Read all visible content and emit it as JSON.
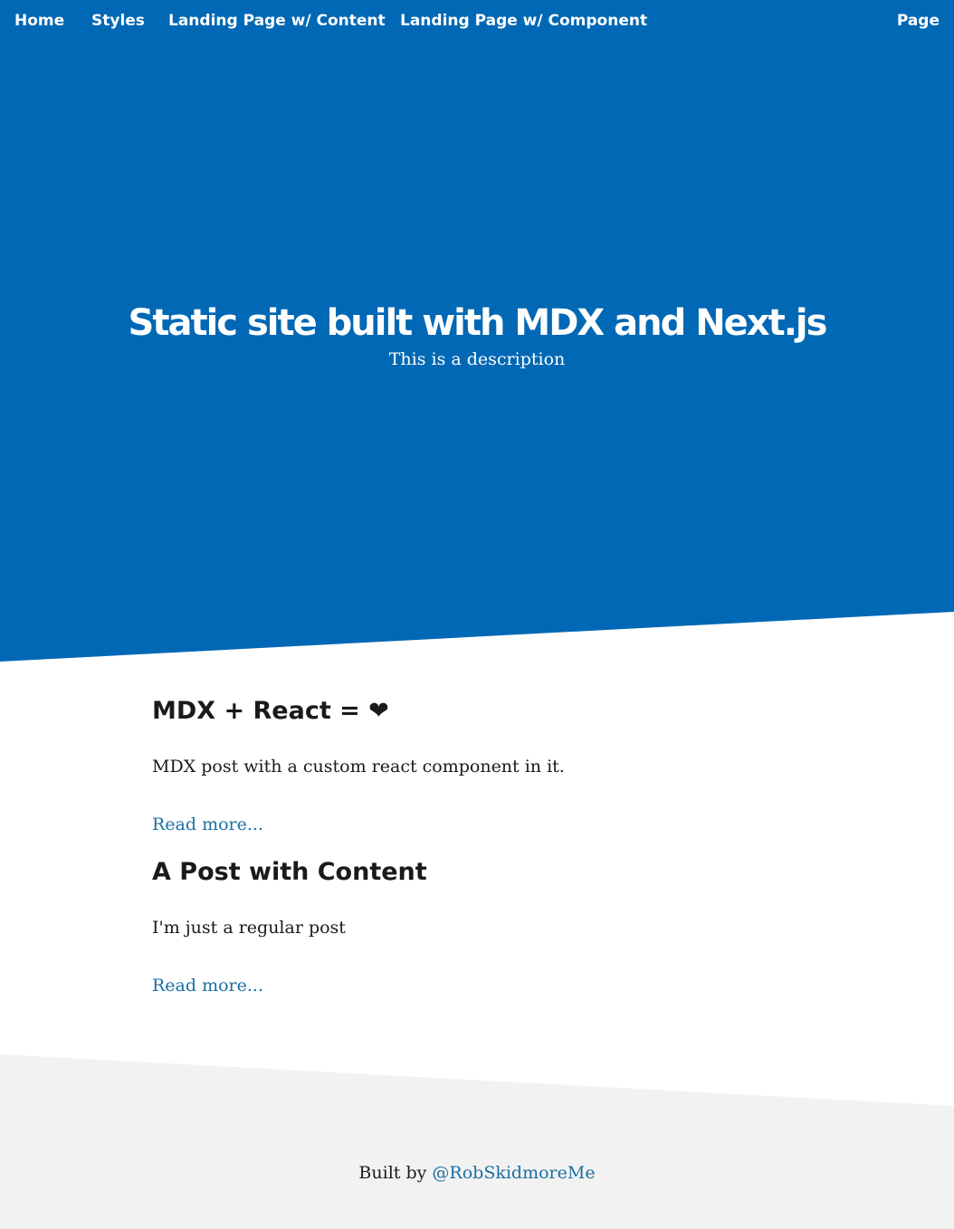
{
  "nav": {
    "home": "Home",
    "styles": "Styles",
    "landing_content": "Landing Page w/ Content",
    "landing_component": "Landing Page w/ Component",
    "page": "Page"
  },
  "hero": {
    "title": "Static site built with MDX and Next.js",
    "description": "This is a description"
  },
  "posts": [
    {
      "title": "MDX + React = ❤",
      "excerpt": "MDX post with a custom react component in it.",
      "read_more": "Read more..."
    },
    {
      "title": "A Post with Content",
      "excerpt": "I'm just a regular post",
      "read_more": "Read more..."
    }
  ],
  "footer": {
    "prefix": "Built by",
    "author_link": "@RobSkidmoreMe"
  },
  "colors": {
    "hero_background": "#0068b5",
    "footer_background": "#f2f2f2",
    "link": "#1a6fa3",
    "text": "#1a1a1a"
  }
}
